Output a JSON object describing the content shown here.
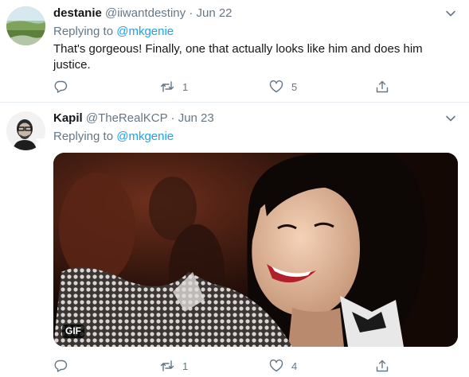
{
  "tweets": [
    {
      "name": "destanie",
      "handle": "@iiwantdestiny",
      "separator": "·",
      "date": "Jun 22",
      "replying_label": "Replying to",
      "replying_to": "@mkgenie",
      "text": "That's gorgeous! Finally, one that actually looks like him and does him justice.",
      "retweet_count": "1",
      "like_count": "5"
    },
    {
      "name": "Kapil",
      "handle": "@TheRealKCP",
      "separator": "·",
      "date": "Jun 23",
      "replying_label": "Replying to",
      "replying_to": "@mkgenie",
      "media_badge": "GIF",
      "retweet_count": "1",
      "like_count": "4"
    }
  ],
  "icons": [
    "chevron-down-icon",
    "reply-icon",
    "retweet-icon",
    "like-icon",
    "share-icon"
  ],
  "colors": {
    "link": "#1da1f2",
    "secondary_text": "#657786",
    "divider": "#e6ecf0"
  }
}
